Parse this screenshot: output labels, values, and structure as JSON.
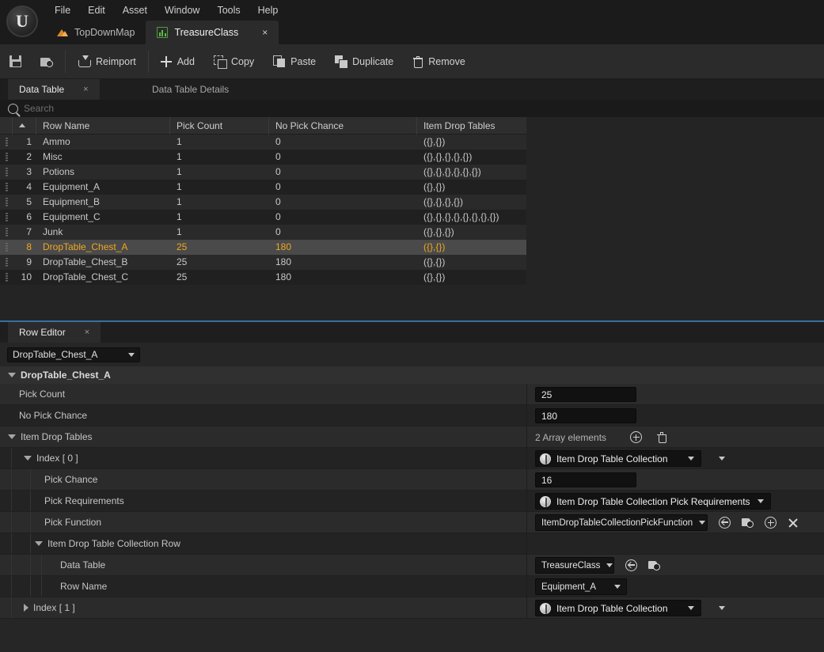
{
  "app": {
    "logo_glyph": "U",
    "menu": [
      "File",
      "Edit",
      "Asset",
      "Window",
      "Tools",
      "Help"
    ],
    "tabs": [
      {
        "label": "TopDownMap",
        "icon": "map-icon",
        "active": false,
        "closable": false
      },
      {
        "label": "TreasureClass",
        "icon": "datatable-icon",
        "active": true,
        "closable": true,
        "close_glyph": "×"
      }
    ]
  },
  "toolbar": {
    "buttons": [
      {
        "label": "",
        "icon": "save-icon",
        "name": "save-button"
      },
      {
        "label": "",
        "icon": "browse-icon",
        "name": "browse-button"
      },
      {
        "label": "Reimport",
        "icon": "reimport-icon",
        "name": "reimport-button"
      },
      {
        "label": "Add",
        "icon": "plus-icon",
        "name": "add-button"
      },
      {
        "label": "Copy",
        "icon": "copy-icon",
        "name": "copy-button"
      },
      {
        "label": "Paste",
        "icon": "paste-icon",
        "name": "paste-button"
      },
      {
        "label": "Duplicate",
        "icon": "duplicate-icon",
        "name": "duplicate-button"
      },
      {
        "label": "Remove",
        "icon": "trash-icon",
        "name": "remove-button"
      }
    ]
  },
  "data_table_panel": {
    "tabs": [
      {
        "label": "Data Table",
        "active": true,
        "close_glyph": "×"
      },
      {
        "label": "Data Table Details",
        "active": false
      }
    ],
    "search": {
      "placeholder": "Search",
      "value": ""
    },
    "columns": [
      "Row Name",
      "Pick Count",
      "No Pick Chance",
      "Item Drop Tables"
    ],
    "sorted_column": "Row Name",
    "sort_direction": "ascending",
    "rows": [
      {
        "index": "1",
        "row_name": "Ammo",
        "pick_count": "1",
        "no_pick_chance": "0",
        "item_drop_tables": "({},{})",
        "selected": false
      },
      {
        "index": "2",
        "row_name": "Misc",
        "pick_count": "1",
        "no_pick_chance": "0",
        "item_drop_tables": "({},{},{},{},{})",
        "selected": false
      },
      {
        "index": "3",
        "row_name": "Potions",
        "pick_count": "1",
        "no_pick_chance": "0",
        "item_drop_tables": "({},{},{},{},{},{})",
        "selected": false
      },
      {
        "index": "4",
        "row_name": "Equipment_A",
        "pick_count": "1",
        "no_pick_chance": "0",
        "item_drop_tables": "({},{})",
        "selected": false
      },
      {
        "index": "5",
        "row_name": "Equipment_B",
        "pick_count": "1",
        "no_pick_chance": "0",
        "item_drop_tables": "({},{},{},{})",
        "selected": false
      },
      {
        "index": "6",
        "row_name": "Equipment_C",
        "pick_count": "1",
        "no_pick_chance": "0",
        "item_drop_tables": "({},{},{},{},{},{},{},{})",
        "selected": false
      },
      {
        "index": "7",
        "row_name": "Junk",
        "pick_count": "1",
        "no_pick_chance": "0",
        "item_drop_tables": "({},{},{})",
        "selected": false
      },
      {
        "index": "8",
        "row_name": "DropTable_Chest_A",
        "pick_count": "25",
        "no_pick_chance": "180",
        "item_drop_tables": "({},{})",
        "selected": true
      },
      {
        "index": "9",
        "row_name": "DropTable_Chest_B",
        "pick_count": "25",
        "no_pick_chance": "180",
        "item_drop_tables": "({},{})",
        "selected": false
      },
      {
        "index": "10",
        "row_name": "DropTable_Chest_C",
        "pick_count": "25",
        "no_pick_chance": "180",
        "item_drop_tables": "({},{})",
        "selected": false
      }
    ]
  },
  "row_editor": {
    "tab": {
      "label": "Row Editor",
      "close_glyph": "×"
    },
    "row_selector": {
      "value": "DropTable_Chest_A"
    },
    "root_category": "DropTable_Chest_A",
    "properties": {
      "pick_count": {
        "label": "Pick Count",
        "value": "25"
      },
      "no_pick_chance": {
        "label": "No Pick Chance",
        "value": "180"
      },
      "item_drop_tables": {
        "label": "Item Drop Tables",
        "array_count_text": "2 Array elements",
        "elements": [
          {
            "label": "Index [ 0 ]",
            "type_value": "Item Drop Table Collection",
            "expanded": true,
            "pick_chance": {
              "label": "Pick Chance",
              "value": "16"
            },
            "pick_requirements": {
              "label": "Pick Requirements",
              "value": "Item Drop Table Collection Pick Requirements"
            },
            "pick_function": {
              "label": "Pick Function",
              "value": "ItemDropTableCollectionPickFunction"
            },
            "collection_row": {
              "label": "Item Drop Table Collection Row",
              "data_table": {
                "label": "Data Table",
                "value": "TreasureClass"
              },
              "row_name": {
                "label": "Row Name",
                "value": "Equipment_A"
              }
            }
          },
          {
            "label": "Index [ 1 ]",
            "type_value": "Item Drop Table Collection",
            "expanded": false
          }
        ]
      }
    }
  },
  "colors": {
    "selection_text": "#f0a71e",
    "selection_bg": "#4a4a4a",
    "panel_bg": "#242424",
    "accent_border": "#3a6ea5"
  }
}
